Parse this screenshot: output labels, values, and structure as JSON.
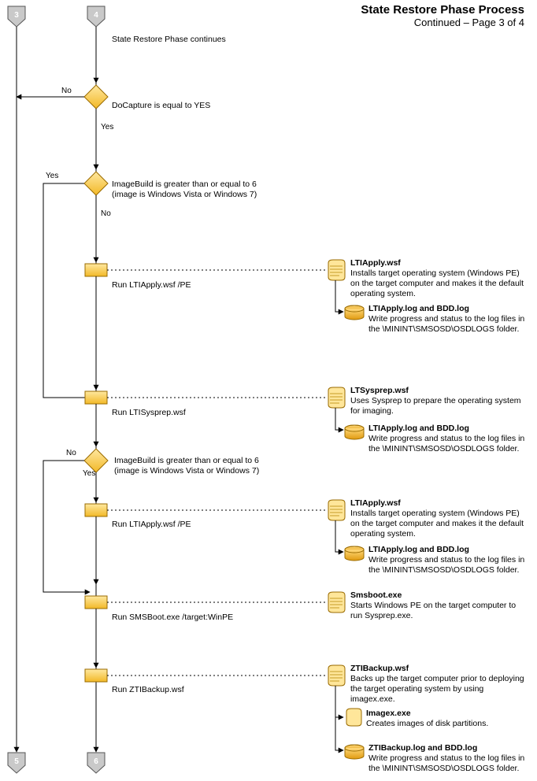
{
  "header": {
    "title": "State Restore Phase Process",
    "subtitle": "Continued – Page 3 of 4"
  },
  "connectors": {
    "in_left": "3",
    "in_mid": "4",
    "out_left": "5",
    "out_mid": "6"
  },
  "flow": {
    "continue": "State Restore Phase continues",
    "d1": {
      "text": "DoCapture is equal to YES",
      "yes": "Yes",
      "no": "No"
    },
    "d2": {
      "text": "ImageBuild is greater than or equal to 6\n(image is Windows Vista or Windows 7)",
      "yes": "Yes",
      "no": "No"
    },
    "p1": "Run LTIApply.wsf /PE",
    "p2": "Run LTISysprep.wsf",
    "d3": {
      "text": "ImageBuild is greater than or equal to 6\n(image is Windows Vista or Windows 7)",
      "yes": "Yes",
      "no": "No"
    },
    "p3": "Run LTIApply.wsf /PE",
    "p4": "Run SMSBoot.exe /target:WinPE",
    "p5": "Run ZTIBackup.wsf"
  },
  "annotations": {
    "a1": {
      "title": "LTIApply.wsf",
      "body": "Installs target operating system (Windows PE) on the target computer and makes it the default operating system.",
      "log_title": "LTIApply.log and BDD.log",
      "log_body": "Write progress and status to the log files in the \\MININT\\SMSOSD\\OSDLOGS folder."
    },
    "a2": {
      "title": "LTSysprep.wsf",
      "body": "Uses Sysprep to prepare the operating system for imaging.",
      "log_title": "LTIApply.log and BDD.log",
      "log_body": "Write progress and status to the log files in the \\MININT\\SMSOSD\\OSDLOGS folder."
    },
    "a3": {
      "title": "LTIApply.wsf",
      "body": "Installs target operating system (Windows PE) on the target computer and makes it the default operating system.",
      "log_title": "LTIApply.log and BDD.log",
      "log_body": "Write progress and status to the log files in the \\MININT\\SMSOSD\\OSDLOGS folder."
    },
    "a4": {
      "title": "Smsboot.exe",
      "body": "Starts Windows PE on the target computer to run Sysprep.exe."
    },
    "a5": {
      "title": "ZTIBackup.wsf",
      "body": "Backs up the target computer prior to deploying the target operating system by using imagex.exe.",
      "sub_title": "Imagex.exe",
      "sub_body": "Creates images of disk partitions.",
      "log_title": "ZTIBackup.log and BDD.log",
      "log_body": "Write progress and status to the log files in the \\MININT\\SMSOSD\\OSDLOGS folder."
    }
  }
}
